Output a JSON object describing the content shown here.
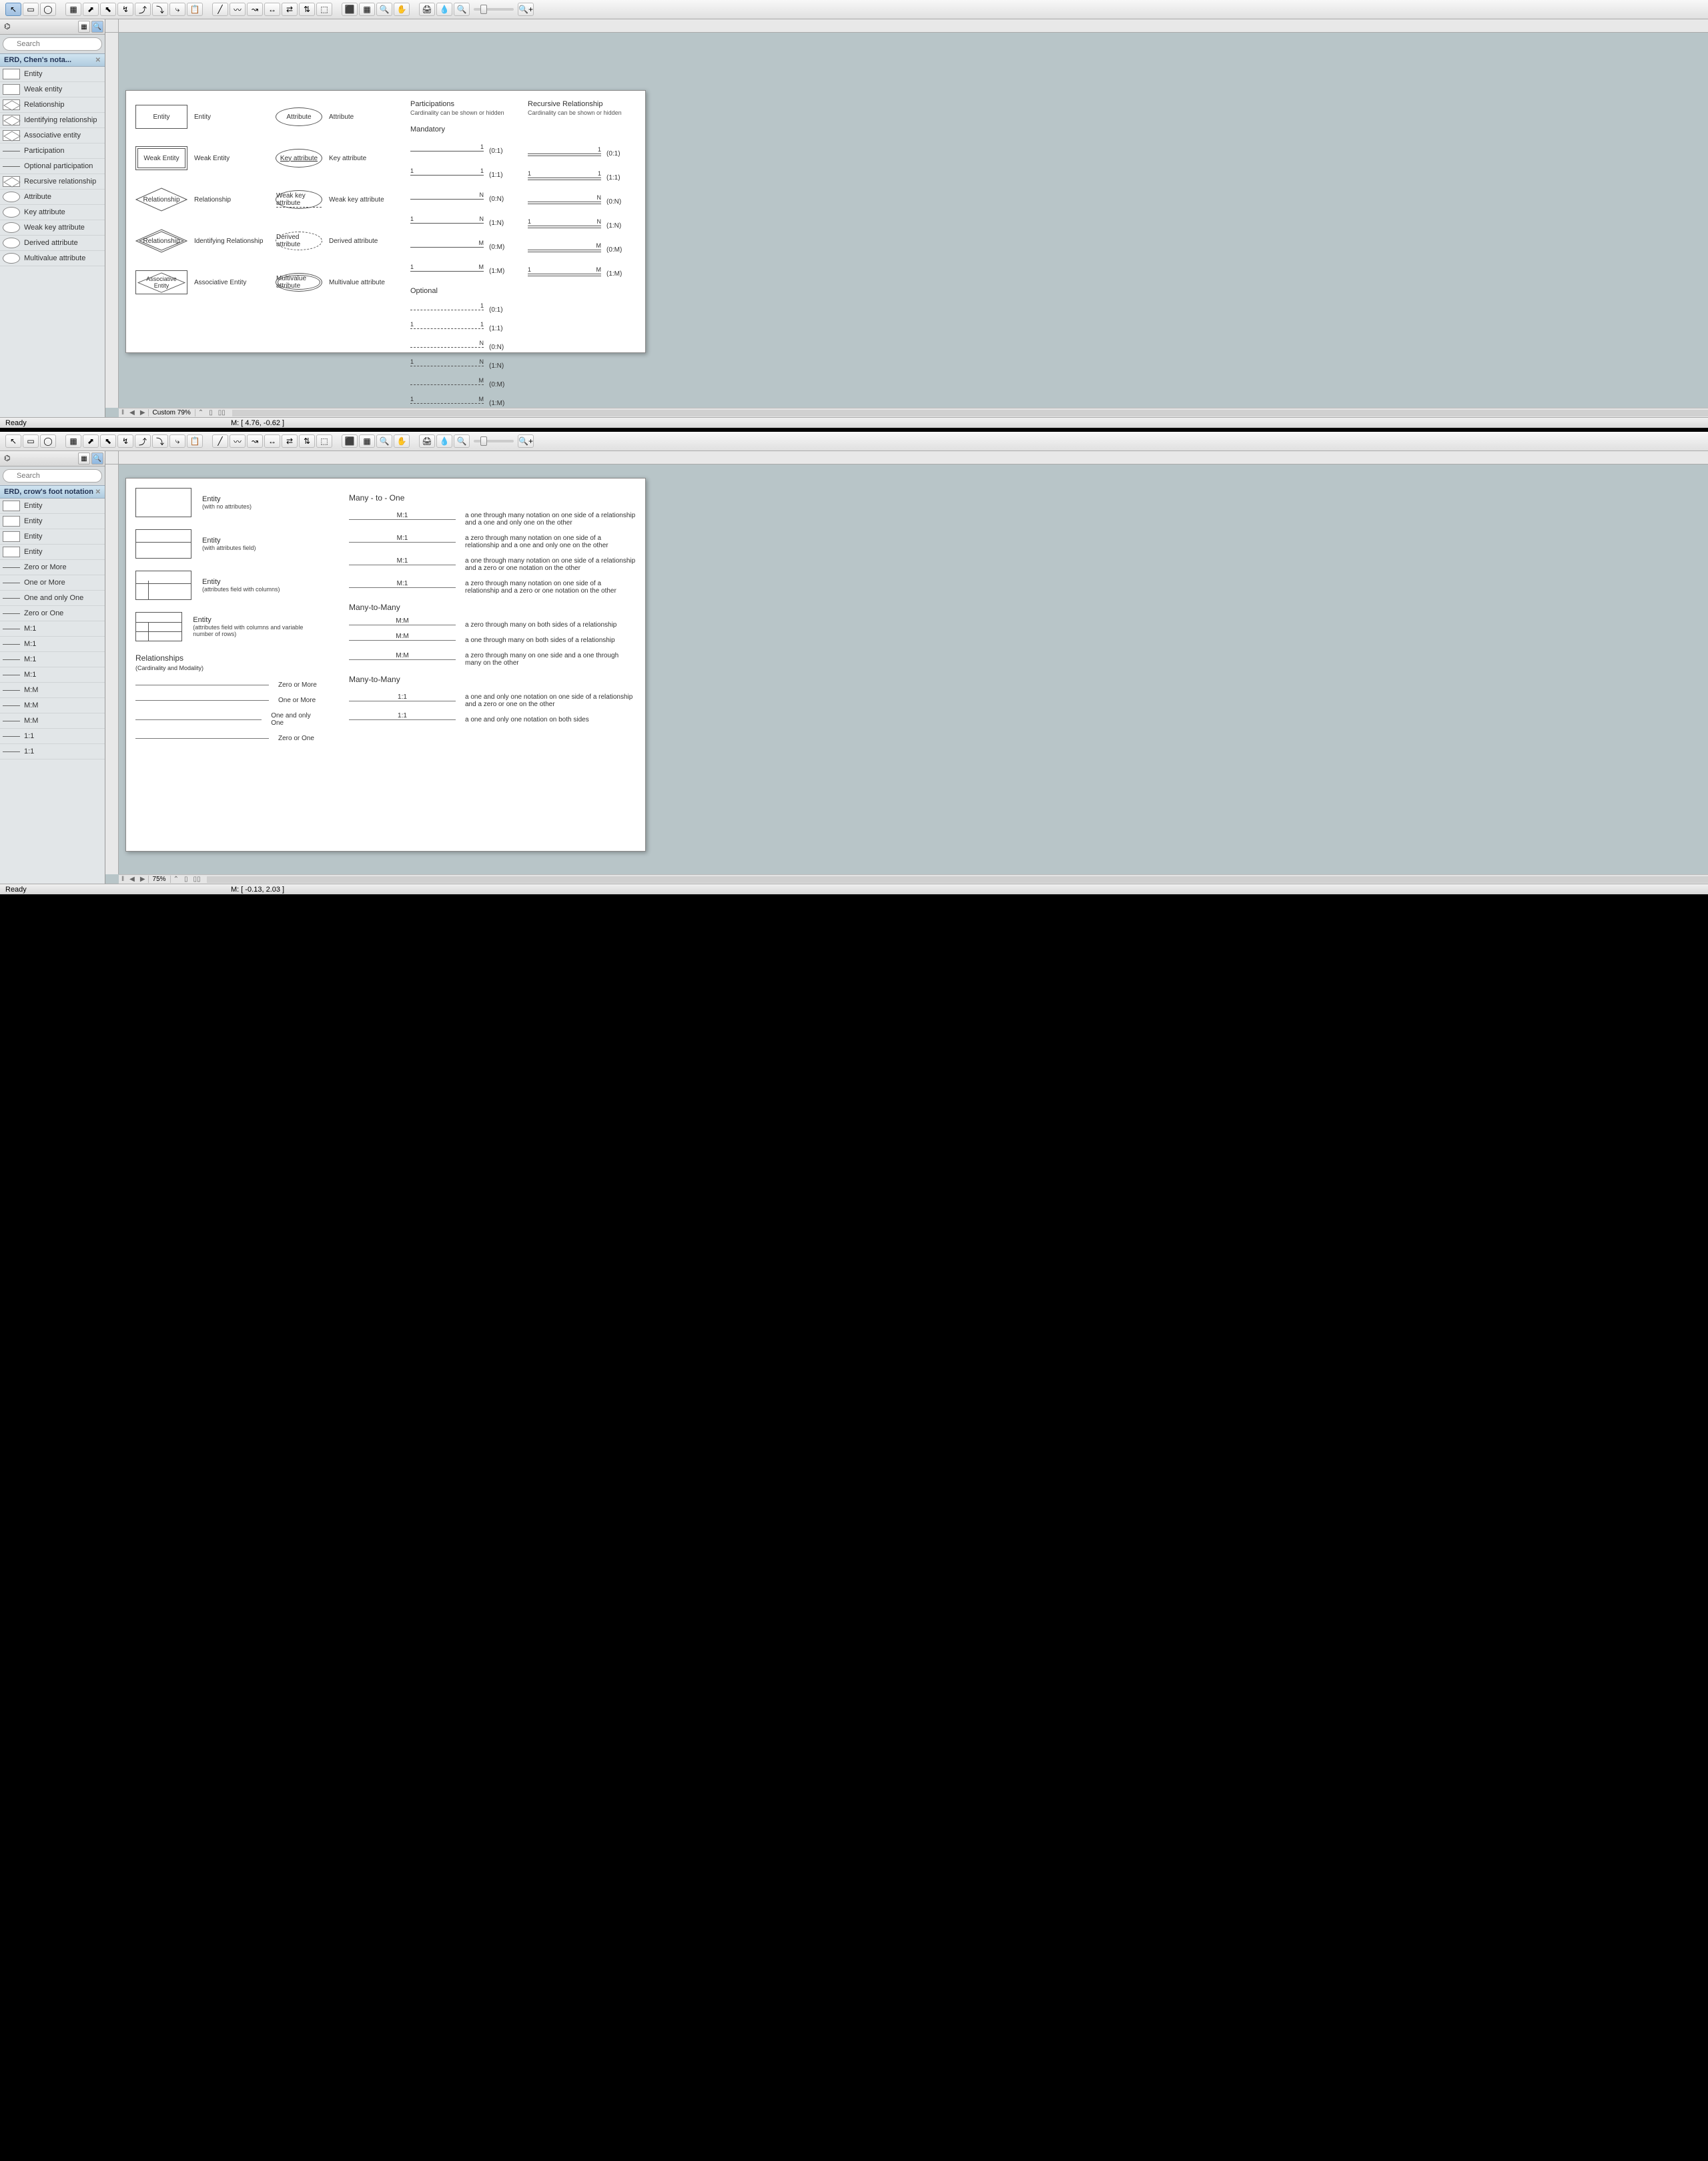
{
  "app1": {
    "toolbar_icons": [
      "pointer",
      "rect",
      "ellipse",
      "table",
      "connector-right",
      "connector-up",
      "connector-cross",
      "connector-step",
      "connector-arc",
      "connector-branch",
      "paste",
      "line",
      "curve",
      "polyline",
      "arrow-h",
      "double-arrow",
      "arrow-vh",
      "group",
      "ungroup",
      "align",
      "zoom-in",
      "hand",
      "print",
      "color-picker",
      "zoom-out-small",
      "zoom-in-small"
    ],
    "search_placeholder": "Search",
    "panel_title": "ERD, Chen's nota...",
    "shapes": [
      "Entity",
      "Weak entity",
      "Relationship",
      "Identifying relationship",
      "Associative entity",
      "Participation",
      "Optional participation",
      "Recursive relationship",
      "Attribute",
      "Key attribute",
      "Weak key attribute",
      "Derived attribute",
      "Multivalue attribute"
    ],
    "page": {
      "entity_rows": [
        {
          "shape": "Entity",
          "label": "Entity"
        },
        {
          "shape": "Weak Entity",
          "label": "Weak Entity"
        },
        {
          "shape": "Relationship",
          "label": "Relationship",
          "kind": "dia"
        },
        {
          "shape": "Relationship",
          "label": "Identifying Relationship",
          "kind": "dia-double"
        },
        {
          "shape": "Associative Entity",
          "label": "Associative Entity",
          "kind": "assoc"
        }
      ],
      "attr_rows": [
        {
          "shape": "Attribute",
          "label": "Attribute"
        },
        {
          "shape": "Key attribute",
          "label": "Key attribute",
          "under": true
        },
        {
          "shape": "Weak key attribute",
          "label": "Weak key attribute",
          "dashunder": true
        },
        {
          "shape": "Derived attribute",
          "label": "Derived attribute",
          "dashed": true
        },
        {
          "shape": "Multivalue attribute",
          "label": "Multivalue attribute",
          "double": true
        }
      ],
      "participations_title": "Participations",
      "participations_sub": "Cardinality can be shown or hidden",
      "mandatory_title": "Mandatory",
      "optional_title": "Optional",
      "mandatory": [
        {
          "l": "",
          "r": "1",
          "tag": "(0:1)"
        },
        {
          "l": "1",
          "r": "1",
          "tag": "(1:1)"
        },
        {
          "l": "",
          "r": "N",
          "tag": "(0:N)"
        },
        {
          "l": "1",
          "r": "N",
          "tag": "(1:N)"
        },
        {
          "l": "",
          "r": "M",
          "tag": "(0:M)"
        },
        {
          "l": "1",
          "r": "M",
          "tag": "(1:M)"
        }
      ],
      "optional": [
        {
          "l": "",
          "r": "1",
          "tag": "(0:1)"
        },
        {
          "l": "1",
          "r": "1",
          "tag": "(1:1)"
        },
        {
          "l": "",
          "r": "N",
          "tag": "(0:N)"
        },
        {
          "l": "1",
          "r": "N",
          "tag": "(1:N)"
        },
        {
          "l": "",
          "r": "M",
          "tag": "(0:M)"
        },
        {
          "l": "1",
          "r": "M",
          "tag": "(1:M)"
        }
      ],
      "recursive_title": "Recursive Relationship",
      "recursive_sub": "Cardinality can be shown or hidden",
      "recursive": [
        {
          "l": "",
          "r": "1",
          "tag": "(0:1)"
        },
        {
          "l": "1",
          "r": "1",
          "tag": "(1:1)"
        },
        {
          "l": "",
          "r": "N",
          "tag": "(0:N)"
        },
        {
          "l": "1",
          "r": "N",
          "tag": "(1:N)"
        },
        {
          "l": "",
          "r": "M",
          "tag": "(0:M)"
        },
        {
          "l": "1",
          "r": "M",
          "tag": "(1:M)"
        }
      ]
    },
    "status_ready": "Ready",
    "status_zoom": "Custom 79%",
    "status_coord": "M: [ 4.76, -0.62 ]"
  },
  "app2": {
    "search_placeholder": "Search",
    "panel_title": "ERD, crow's foot notation",
    "shapes": [
      "Entity",
      "Entity",
      "Entity",
      "Entity",
      "Zero or More",
      "One or More",
      "One and only One",
      "Zero or One",
      "M:1",
      "M:1",
      "M:1",
      "M:1",
      "M:M",
      "M:M",
      "M:M",
      "1:1",
      "1:1"
    ],
    "page": {
      "entities": [
        {
          "title": "Entity",
          "sub": "(with no attributes)",
          "lines": []
        },
        {
          "title": "Entity",
          "sub": "(with attributes field)",
          "lines": [
            {
              "h": 18
            }
          ]
        },
        {
          "title": "Entity",
          "sub": "(attributes field with columns)",
          "lines": [
            {
              "h": 18
            },
            {
              "v": 18
            }
          ]
        },
        {
          "title": "Entity",
          "sub": "(attributes field with columns and variable number of rows)",
          "lines": [
            {
              "h": 14
            },
            {
              "h": 28
            },
            {
              "v": 18
            }
          ]
        }
      ],
      "rel_header": "Relationships",
      "rel_sub": "(Cardinality and Modality)",
      "basic_rels": [
        {
          "label": "Zero or More"
        },
        {
          "label": "One or More"
        },
        {
          "label": "One and only One"
        },
        {
          "label": "Zero or One"
        }
      ],
      "m1_title": "Many - to - One",
      "m1": [
        {
          "tag": "M:1",
          "desc": "a one through many notation on one side of a relationship and a one and only one on the other"
        },
        {
          "tag": "M:1",
          "desc": "a zero through many notation on one side of a relationship and a one and only one on the other"
        },
        {
          "tag": "M:1",
          "desc": "a one through many notation on one side of a relationship and a zero or one notation on the other"
        },
        {
          "tag": "M:1",
          "desc": "a zero through many notation on one side of a relationship and a zero or one notation on the other"
        }
      ],
      "mm_title": "Many-to-Many",
      "mm": [
        {
          "tag": "M:M",
          "desc": "a zero through many on both sides of a relationship"
        },
        {
          "tag": "M:M",
          "desc": "a one through many on both sides of a relationship"
        },
        {
          "tag": "M:M",
          "desc": "a zero through many on one side and a one through many on the other"
        }
      ],
      "oo_title": "Many-to-Many",
      "oo": [
        {
          "tag": "1:1",
          "desc": "a one and only one notation on one side of a relationship and a zero or one on the other"
        },
        {
          "tag": "1:1",
          "desc": "a one and only one notation on both sides"
        }
      ]
    },
    "status_ready": "Ready",
    "status_zoom": "75%",
    "status_coord": "M: [ -0.13, 2.03 ]"
  }
}
